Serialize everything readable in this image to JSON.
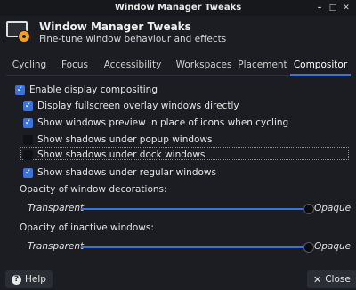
{
  "window": {
    "title": "Window Manager Tweaks",
    "controls": {
      "minimize": "–",
      "maximize": "□",
      "close": "✕"
    }
  },
  "header": {
    "title": "Window Manager Tweaks",
    "subtitle": "Fine-tune window behaviour and effects"
  },
  "tabs": [
    {
      "label": "Cycling",
      "active": false
    },
    {
      "label": "Focus",
      "active": false
    },
    {
      "label": "Accessibility",
      "active": false
    },
    {
      "label": "Workspaces",
      "active": false
    },
    {
      "label": "Placement",
      "active": false
    },
    {
      "label": "Compositor",
      "active": true
    }
  ],
  "compositor": {
    "enable": {
      "label": "Enable display compositing",
      "checked": true
    },
    "options": [
      {
        "label": "Display fullscreen overlay windows directly",
        "checked": true
      },
      {
        "label": "Show windows preview in place of icons when cycling",
        "checked": true
      },
      {
        "label": "Show shadows under popup windows",
        "checked": false
      },
      {
        "label": "Show shadows under dock windows",
        "checked": false
      },
      {
        "label": "Show shadows under regular windows",
        "checked": true
      }
    ],
    "decorations_opacity": {
      "label": "Opacity of window decorations:",
      "min_label": "Transparent",
      "max_label": "Opaque",
      "value_fraction": 1.0
    },
    "inactive_opacity": {
      "label": "Opacity of inactive windows:",
      "min_label": "Transparent",
      "max_label": "Opaque",
      "value_fraction": 1.0
    }
  },
  "buttons": {
    "help": "Help",
    "close": "Close"
  },
  "colors": {
    "accent": "#3a74d8",
    "background": "#1b1d22",
    "icon_gear": "#f5a025"
  },
  "icons": {
    "app": "window-manager-tweaks-icon",
    "help": "help-icon",
    "close": "close-icon"
  }
}
